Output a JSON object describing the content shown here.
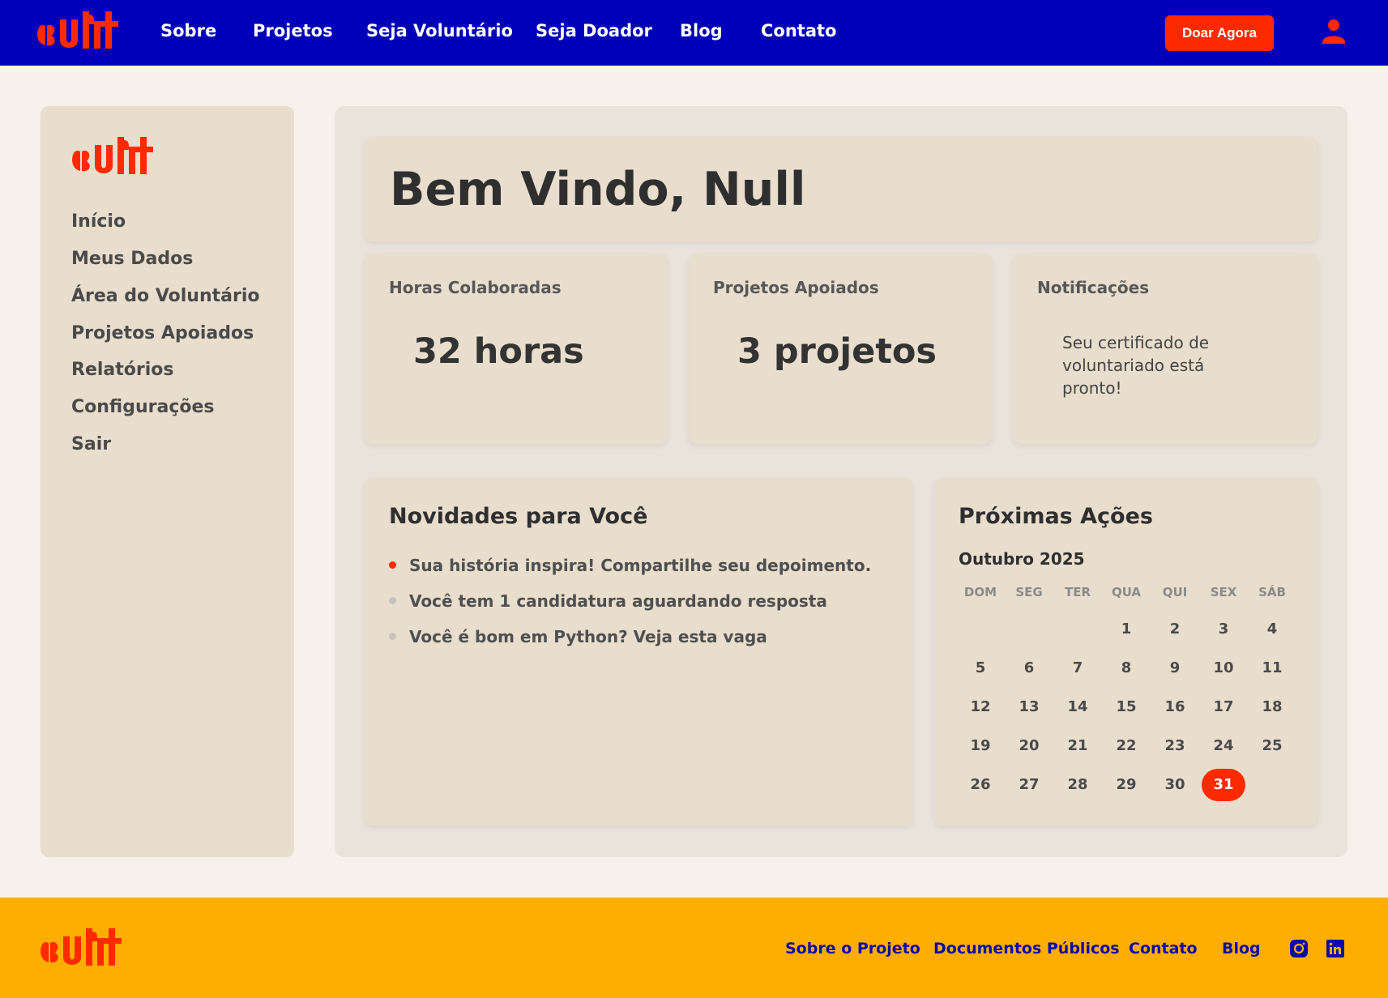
{
  "brand": {
    "accent": "#ff2a00",
    "header_bg": "#0000b8",
    "footer_bg": "#ffae00",
    "footer_link": "#0a0aa8",
    "logo_icon": "brand-logo-icon"
  },
  "nav": {
    "links": [
      "Sobre",
      "Projetos",
      "Seja Voluntário",
      "Seja Doador",
      "Blog",
      "Contato"
    ],
    "donate_label": "Doar Agora",
    "user_icon": "user-icon"
  },
  "sidebar": {
    "items": [
      "Início",
      "Meus Dados",
      "Área do Voluntário",
      "Projetos Apoiados",
      "Relatórios",
      "Configurações",
      "Sair"
    ]
  },
  "welcome": {
    "title": "Bem Vindo, Null"
  },
  "stats": [
    {
      "label": "Horas Colaboradas",
      "value": "32 horas"
    },
    {
      "label": "Projetos Apoiados",
      "value": "3 projetos"
    },
    {
      "label": "Notificações",
      "value": "Seu certificado de voluntariado está pronto!"
    }
  ],
  "news": {
    "title": "Novidades para Você",
    "items": [
      "Sua história inspira! Compartilhe seu depoimento.",
      "Você tem 1 candidatura aguardando resposta",
      "Você é bom em Python? Veja esta vaga"
    ],
    "active_index": 0
  },
  "calendar": {
    "title": "Próximas Ações",
    "month": "Outubro 2025",
    "weekdays": [
      "DOM",
      "SEG",
      "TER",
      "QUA",
      "QUI",
      "SEX",
      "SÁB"
    ],
    "first_weekday": 3,
    "days": 31,
    "today": 31
  },
  "footer": {
    "links": [
      "Sobre o Projeto",
      "Documentos Públicos",
      "Contato",
      "Blog"
    ],
    "social": [
      "instagram-icon",
      "linkedin-icon"
    ]
  }
}
